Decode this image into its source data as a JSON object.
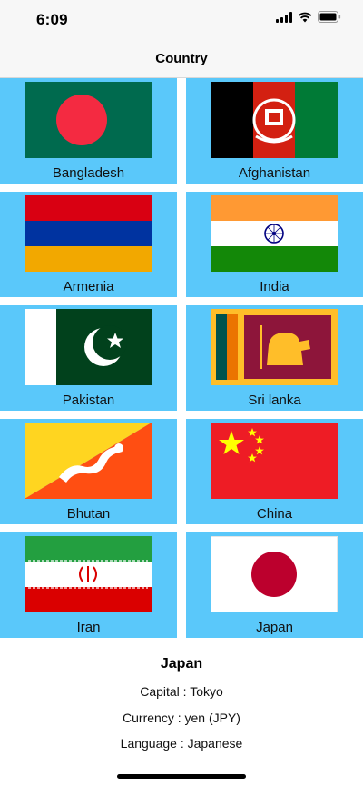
{
  "status": {
    "time": "6:09",
    "icons": [
      "signal-icon",
      "wifi-icon",
      "battery-icon"
    ]
  },
  "nav": {
    "title": "Country"
  },
  "grid": {
    "background": "#5ac8fa",
    "countries": [
      {
        "label": "Bangladesh",
        "flag": "bangladesh-flag-icon"
      },
      {
        "label": "Afghanistan",
        "flag": "afghanistan-flag-icon"
      },
      {
        "label": "Armenia",
        "flag": "armenia-flag-icon"
      },
      {
        "label": "India",
        "flag": "india-flag-icon"
      },
      {
        "label": "Pakistan",
        "flag": "pakistan-flag-icon"
      },
      {
        "label": "Sri lanka",
        "flag": "sri-lanka-flag-icon"
      },
      {
        "label": "Bhutan",
        "flag": "bhutan-flag-icon"
      },
      {
        "label": "China",
        "flag": "china-flag-icon"
      },
      {
        "label": "Iran",
        "flag": "iran-flag-icon"
      },
      {
        "label": "Japan",
        "flag": "japan-flag-icon"
      }
    ]
  },
  "detail": {
    "name": "Japan",
    "capital": "Capital : Tokyo",
    "currency": "Currency : yen (JPY)",
    "language": "Language : Japanese"
  }
}
